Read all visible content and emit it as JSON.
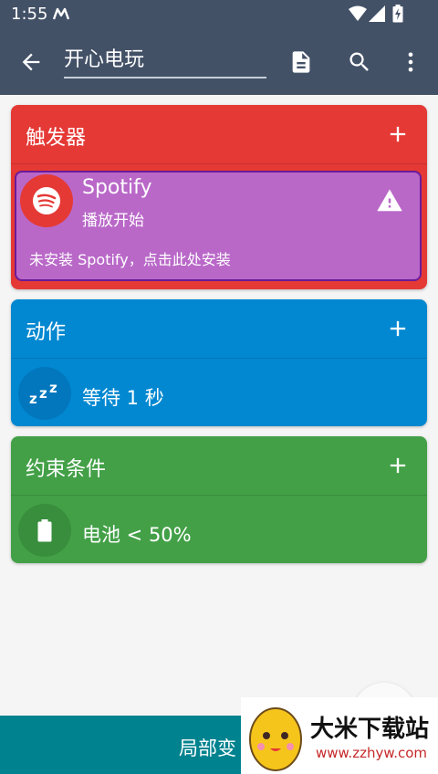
{
  "status_bar": {
    "time": "1:55",
    "notification_icon": "m-icon",
    "wifi_icon": "wifi-icon",
    "signal_icon": "signal-icon",
    "battery_icon": "battery-charging-icon"
  },
  "toolbar": {
    "title": "开心电玩",
    "back_icon": "arrow-back-icon",
    "document_icon": "document-icon",
    "search_icon": "search-icon",
    "more_icon": "more-vert-icon"
  },
  "triggers": {
    "title": "触发器",
    "color": "#e53935",
    "item": {
      "name": "Spotify",
      "subtitle": "播放开始",
      "warning": "未安装 Spotify，点击此处安装",
      "bg_color": "#b968c8"
    }
  },
  "actions": {
    "title": "动作",
    "color": "#0288d1",
    "item": {
      "label": "等待 1 秒",
      "icon": "sleep-zzz-icon"
    }
  },
  "constraints": {
    "title": "约束条件",
    "color": "#43a047",
    "item": {
      "label": "电池 < 50%",
      "icon": "battery-icon"
    }
  },
  "bottom_bar": {
    "label": "局部变"
  },
  "watermark": {
    "title": "大米下载站",
    "url": "www.zzhyw.com"
  }
}
